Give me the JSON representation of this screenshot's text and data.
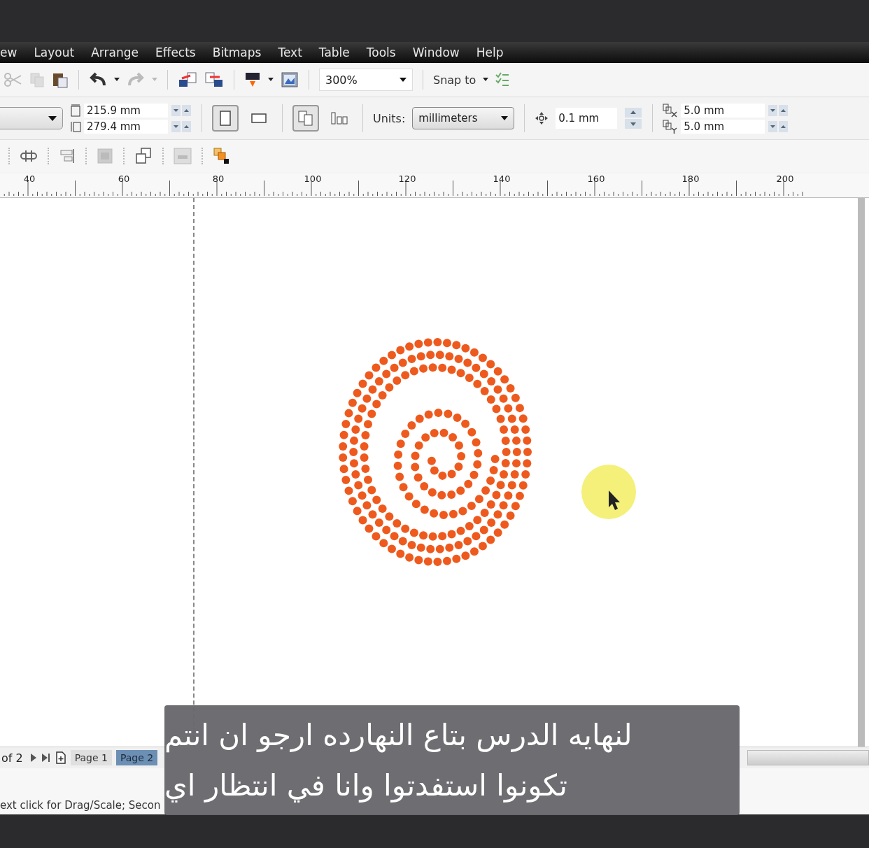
{
  "menu": [
    "ew",
    "Layout",
    "Arrange",
    "Effects",
    "Bitmaps",
    "Text",
    "Table",
    "Tools",
    "Window",
    "Help"
  ],
  "toolbar": {
    "zoom": "300%",
    "snap": "Snap to"
  },
  "property_bar": {
    "width": "215.9 mm",
    "height": "279.4 mm",
    "orientation": [
      {
        "kind": "portrait",
        "selected": true
      },
      {
        "kind": "landscape",
        "selected": false
      }
    ],
    "page_layout": [
      {
        "kind": "all",
        "selected": true
      },
      {
        "kind": "current",
        "selected": false
      }
    ],
    "units_label": "Units:",
    "units": "millimeters",
    "nudge": "0.1 mm",
    "dup_x": "5.0 mm",
    "dup_y": "5.0 mm"
  },
  "ruler": [
    "40",
    "60",
    "80",
    "100",
    "120",
    "140",
    "160",
    "180",
    "200"
  ],
  "page_nav": {
    "counter": "of 2",
    "tabs": [
      {
        "label": "Page 1",
        "selected": false
      },
      {
        "label": "Page 2",
        "selected": true
      }
    ]
  },
  "status_bar": "ext click for Drag/Scale; Secon",
  "subtitle": [
    "لنهايه الدرس بتاع النهارده ارجو ان انتم",
    "تكونوا استفدتوا وانا في انتظار اي"
  ]
}
